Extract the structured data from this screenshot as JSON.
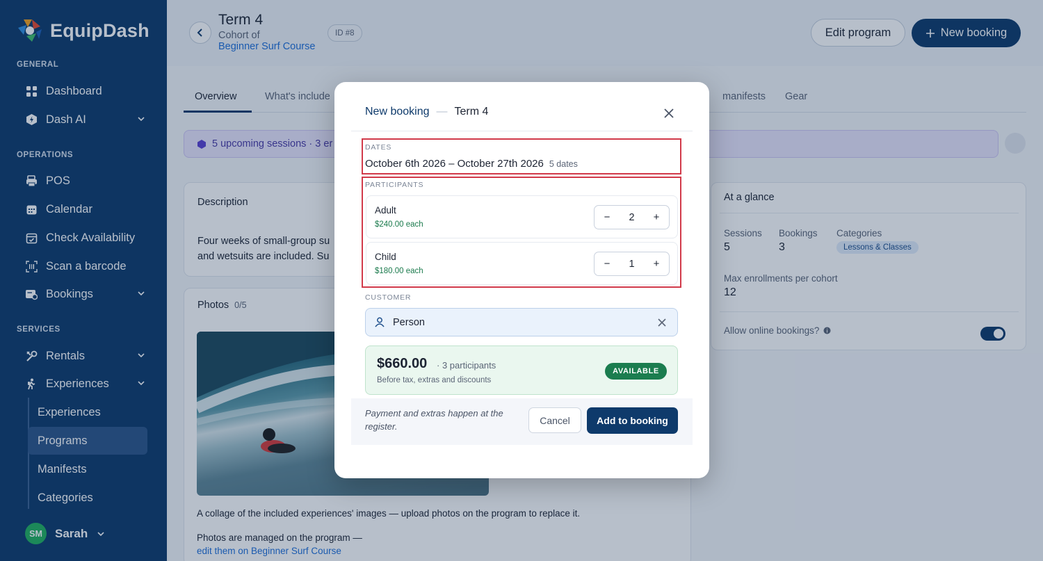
{
  "sidebar": {
    "app_name": "EquipDash",
    "sections": {
      "general": "GENERAL",
      "operations": "OPERATIONS",
      "services": "SERVICES"
    },
    "items": {
      "dashboard": "Dashboard",
      "dash_ai": "Dash AI",
      "pos": "POS",
      "calendar": "Calendar",
      "check_availability": "Check Availability",
      "scan_barcode": "Scan a barcode",
      "bookings": "Bookings",
      "rentals": "Rentals",
      "experiences": "Experiences"
    },
    "sub_items": {
      "experiences": "Experiences",
      "programs": "Programs",
      "manifests": "Manifests",
      "categories": "Categories"
    },
    "user": {
      "initials": "SM",
      "name": "Sarah"
    }
  },
  "header": {
    "title": "Term 4",
    "cohort_prefix": "Cohort of",
    "course_name": "Beginner Surf Course",
    "id_badge": "ID #8",
    "edit_button": "Edit program",
    "new_booking_button": "New booking"
  },
  "tabs": {
    "overview": "Overview",
    "whats_included": "What's include",
    "manifests": "manifests",
    "gear": "Gear"
  },
  "notice": {
    "text": "5 upcoming sessions · 3 er"
  },
  "description": {
    "heading": "Description",
    "line1": "Four weeks of small-group su",
    "line2": "and wetsuits are included. Su"
  },
  "photos": {
    "heading": "Photos",
    "count": "0/5",
    "caption": "A collage of the included experiences' images — upload photos on the program to replace it.",
    "managed_text": "Photos are managed on the program —",
    "managed_link": "edit them on Beginner Surf Course"
  },
  "glance": {
    "heading": "At a glance",
    "sessions_label": "Sessions",
    "sessions_value": "5",
    "bookings_label": "Bookings",
    "bookings_value": "3",
    "categories_label": "Categories",
    "category_chip": "Lessons & Classes",
    "max_label": "Max enrollments per cohort",
    "max_value": "12",
    "online_label": "Allow online bookings?",
    "online_enabled": true
  },
  "modal": {
    "title": "New booking",
    "title_sep": "—",
    "subtitle": "Term 4",
    "dates_label": "DATES",
    "dates_value": "October 6th 2026 – October 27th 2026",
    "dates_count": "5 dates",
    "participants_label": "PARTICIPANTS",
    "participants": [
      {
        "name": "Adult",
        "price": "$240.00 each",
        "qty": "2"
      },
      {
        "name": "Child",
        "price": "$180.00 each",
        "qty": "1"
      }
    ],
    "customer_label": "CUSTOMER",
    "customer_value": "Person",
    "total": "$660.00",
    "total_detail": "· 3 participants",
    "total_note": "Before tax, extras and discounts",
    "availability": "AVAILABLE",
    "footer_note": "Payment and extras happen at the register.",
    "cancel_button": "Cancel",
    "add_button": "Add to booking"
  },
  "colors": {
    "sidebar_bg": "#0e3a6b",
    "primary": "#0e3a6b",
    "highlight_box": "#d13a4a",
    "available_green": "#1b7d4f",
    "link_blue": "#1f6fd8"
  }
}
